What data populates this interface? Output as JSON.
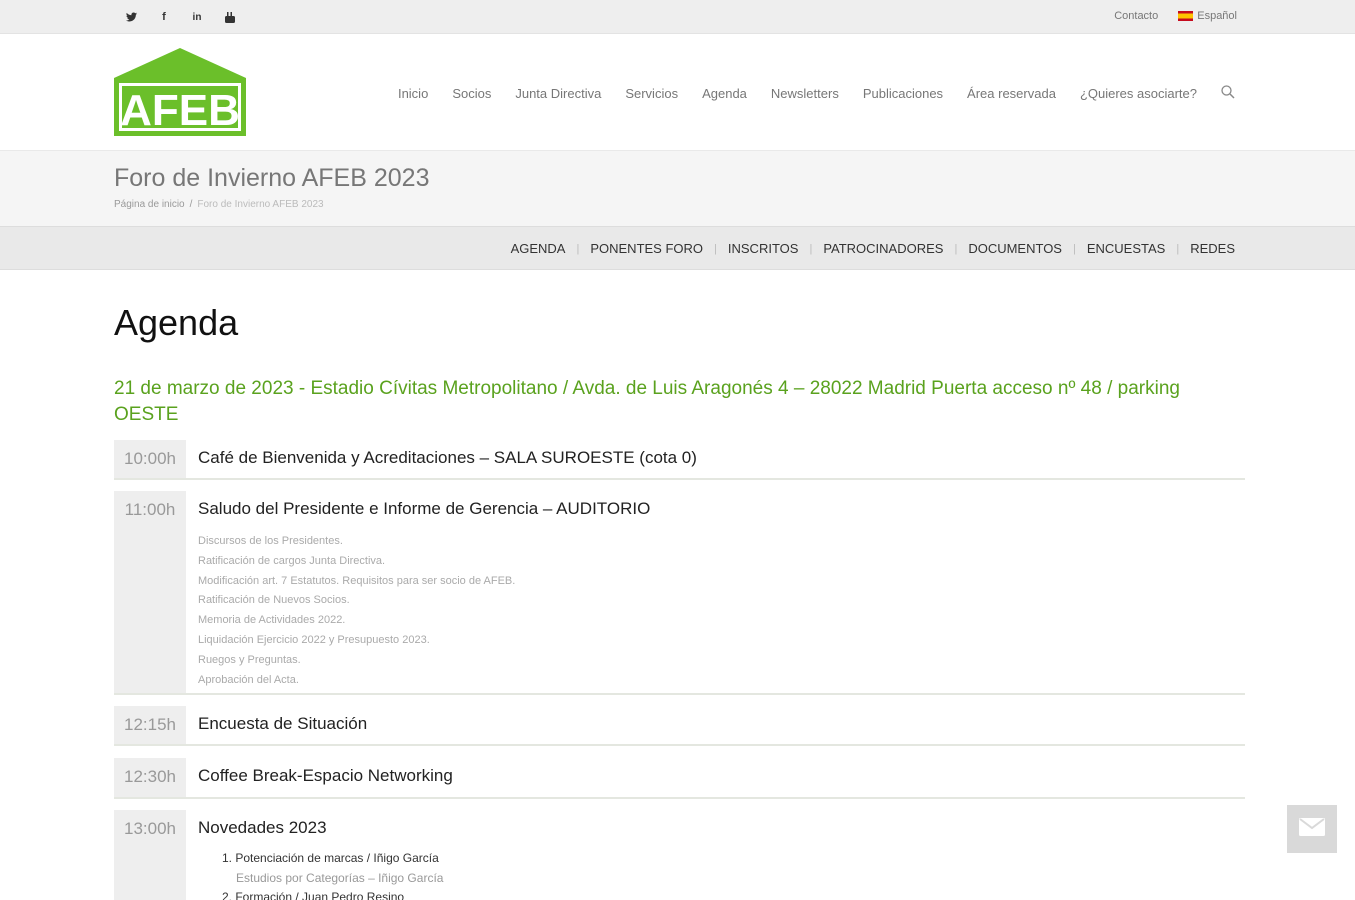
{
  "topbar": {
    "social": [
      {
        "icon": "twitter-icon",
        "glyph": "•"
      },
      {
        "icon": "facebook-icon",
        "glyph": "f"
      },
      {
        "icon": "linkedin-icon",
        "glyph": "in"
      },
      {
        "icon": "youtube-icon",
        "glyph": "▶"
      }
    ],
    "contact_label": "Contacto",
    "language_label": "Español"
  },
  "header": {
    "logo_text": "AFEB",
    "nav": [
      "Inicio",
      "Socios",
      "Junta Directiva",
      "Servicios",
      "Agenda",
      "Newsletters",
      "Publicaciones",
      "Área reservada",
      "¿Quieres asociarte?"
    ]
  },
  "titlebar": {
    "title": "Foro de Invierno AFEB 2023",
    "breadcrumb_home": "Página de inicio",
    "breadcrumb_sep": "/",
    "breadcrumb_current": "Foro de Invierno AFEB 2023"
  },
  "subnav": {
    "items": [
      "AGENDA",
      "PONENTES FORO",
      "INSCRITOS",
      "PATROCINADORES",
      "DOCUMENTOS",
      "ENCUESTAS",
      "REDES"
    ],
    "sep": "|"
  },
  "main": {
    "heading": "Agenda",
    "event_info": "21 de marzo de 2023 - Estadio Cívitas Metropolitano / Avda. de Luis Aragonés 4 – 28022 Madrid Puerta acceso nº 48 / parking OESTE",
    "agenda": [
      {
        "time": "10:00h",
        "title": "Café de Bienvenida y Acreditaciones – SALA SUROESTE (cota 0)"
      },
      {
        "time": "11:00h",
        "title": "Saludo del Presidente e Informe de Gerencia – AUDITORIO",
        "details": [
          "Discursos de los Presidentes.",
          "Ratificación de cargos Junta Directiva.",
          "Modificación art. 7 Estatutos. Requisitos para ser socio de AFEB.",
          "Ratificación de Nuevos Socios.",
          "Memoria de Actividades 2022.",
          "Liquidación Ejercicio 2022 y Presupuesto 2023.",
          "Ruegos y Preguntas.",
          "Aprobación del Acta."
        ]
      },
      {
        "time": "12:15h",
        "title": "Encuesta de Situación"
      },
      {
        "time": "12:30h",
        "title": "Coffee Break-Espacio Networking"
      },
      {
        "time": "13:00h",
        "title": "Novedades 2023",
        "numbered": [
          {
            "label": "1. Potenciación de marcas / Iñigo García",
            "sub": "Estudios por Categorías – Iñigo García"
          },
          {
            "label": "2. Formación / Juan Pedro Resino",
            "sub": ""
          }
        ]
      }
    ]
  },
  "colors": {
    "accent_green": "#5aa21e",
    "logo_green": "#6bbf2a"
  }
}
